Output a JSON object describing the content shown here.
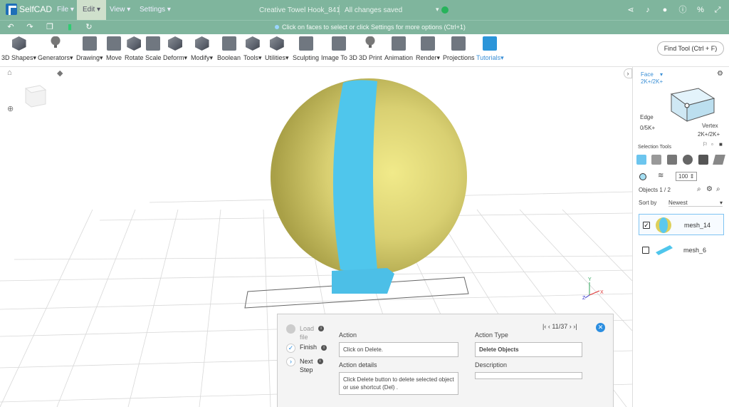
{
  "app": {
    "name": "SelfCAD"
  },
  "menu": {
    "file": "File",
    "edit": "Edit",
    "view": "View",
    "settings": "Settings"
  },
  "document": {
    "title": "Creative Towel Hook_841",
    "save_status": "All changes saved"
  },
  "hint": "Click on faces to select or click Settings for more options (Ctrl+1)",
  "tools": [
    {
      "label": "3D Shapes"
    },
    {
      "label": "Generators"
    },
    {
      "label": "Drawing"
    },
    {
      "label": "Move"
    },
    {
      "label": "Rotate"
    },
    {
      "label": "Scale"
    },
    {
      "label": "Deform"
    },
    {
      "label": "Modify"
    },
    {
      "label": "Boolean"
    },
    {
      "label": "Tools"
    },
    {
      "label": "Utilities"
    },
    {
      "label": "Sculpting"
    },
    {
      "label": "Image To 3D"
    },
    {
      "label": "3D Print"
    },
    {
      "label": "Animation"
    },
    {
      "label": "Render"
    },
    {
      "label": "Projections"
    },
    {
      "label": "Tutorials"
    }
  ],
  "find_tool": "Find Tool (Ctrl + F)",
  "panel": {
    "face_label": "Face",
    "face_count": "2K+/2K+",
    "edge_label": "Edge",
    "edge_count": "0/5K+",
    "vertex_label": "Vertex",
    "vertex_count": "2K+/2K+",
    "selection_tools": "Selection Tools",
    "brush_size": "100",
    "objects": "Objects 1 / 2",
    "sort_label": "Sort by",
    "sort_value": "Newest",
    "items": [
      {
        "name": "mesh_14",
        "checked": true
      },
      {
        "name": "mesh_6",
        "checked": false
      }
    ]
  },
  "tutorial": {
    "steps": [
      {
        "label_1": "Load",
        "label_2": "file"
      },
      {
        "label_1": "Finish",
        "label_2": ""
      },
      {
        "label_1": "Next",
        "label_2": "Step"
      }
    ],
    "pager": "11/37",
    "action_label": "Action",
    "action_value": "Click on Delete.",
    "action_details_label": "Action details",
    "action_details_value": "Click Delete button to delete selected object or use shortcut  (Del) .",
    "action_type_label": "Action Type",
    "action_type_value": "Delete Objects",
    "description_label": "Description",
    "description_value": ""
  },
  "axes": {
    "x": "X",
    "y": "Y",
    "z": "Z"
  },
  "colors": {
    "header": "#7fb59d",
    "sphere": "#d4cc6a",
    "band": "#4fc6ec",
    "accent": "#2b8ee0"
  }
}
